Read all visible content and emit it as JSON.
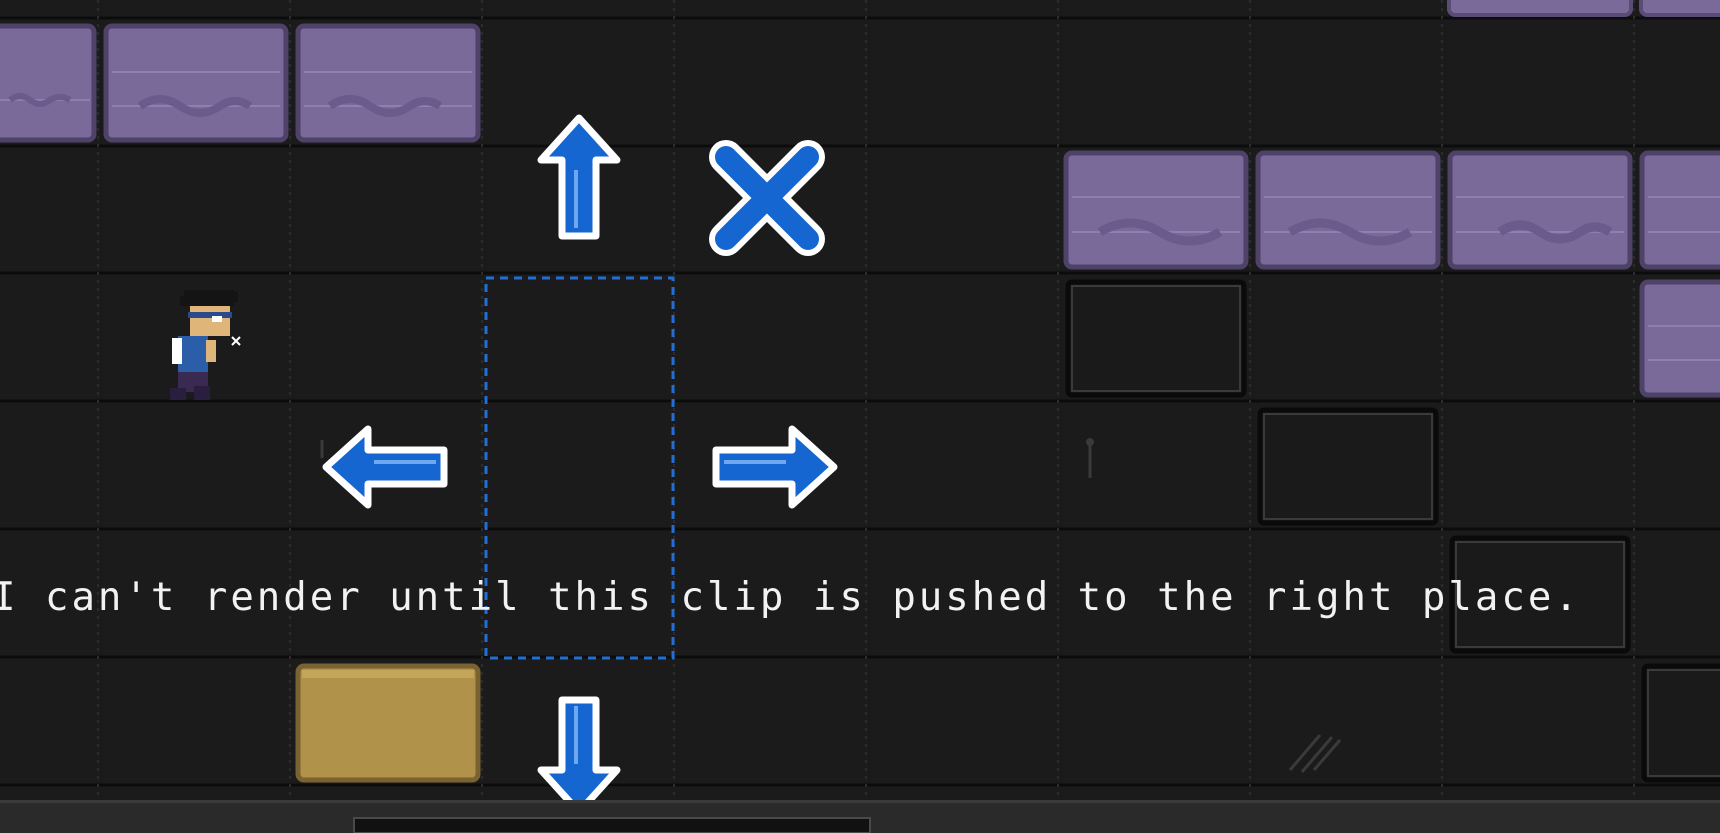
{
  "dialog": {
    "text": "I can't render until this clip is pushed to the right place."
  },
  "controls": [
    {
      "name": "move-up-arrow",
      "icon": "arrow-up-icon"
    },
    {
      "name": "move-down-arrow",
      "icon": "arrow-down-icon"
    },
    {
      "name": "move-left-arrow",
      "icon": "arrow-left-icon"
    },
    {
      "name": "move-right-arrow",
      "icon": "arrow-right-icon"
    },
    {
      "name": "cancel-button",
      "icon": "close-icon"
    }
  ],
  "clips": {
    "audio_clip_color": "#7a6a9a",
    "selected_clip_color": "#b0924a",
    "empty_slot_color": "#1a1a1a"
  },
  "colors": {
    "background": "#1b1b1b",
    "grid_line": "#0d0d0d",
    "arrow_fill": "#1566d0",
    "arrow_outline": "#ffffff",
    "selection_outline": "#1f6fd6",
    "text": "#f2f2f2"
  },
  "character": {
    "icon": "pixel-character-sprite"
  }
}
